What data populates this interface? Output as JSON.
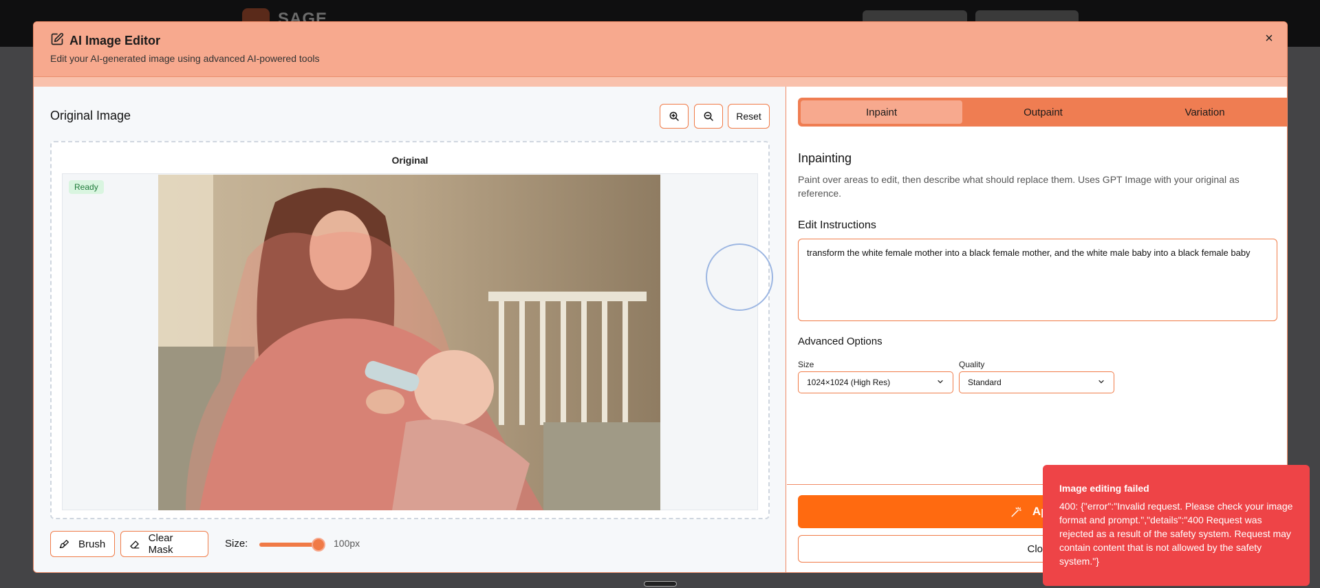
{
  "background": {
    "app_logo_text": "SAGE"
  },
  "modal": {
    "title": "AI Image Editor",
    "subtitle": "Edit your AI-generated image using advanced AI-powered tools",
    "close_symbol": "×"
  },
  "left": {
    "title": "Original Image",
    "reset_label": "Reset",
    "canvas_label": "Original",
    "status_badge": "Ready",
    "brush_label": "Brush",
    "clear_mask_label": "Clear Mask",
    "size_label": "Size:",
    "size_value": "100px",
    "brush_size_fraction": 1.0
  },
  "right": {
    "tabs": [
      {
        "label": "Inpaint",
        "active": true
      },
      {
        "label": "Outpaint",
        "active": false
      },
      {
        "label": "Variation",
        "active": false
      }
    ],
    "section_title": "Inpainting",
    "section_desc": "Paint over areas to edit, then describe what should replace them. Uses GPT Image with your original as reference.",
    "instructions_label": "Edit Instructions",
    "instructions_value": "transform the white female mother into a black female mother, and the white male baby into a black female baby",
    "advanced_title": "Advanced Options",
    "size_option_label": "Size",
    "size_option_value": "1024×1024 (High Res)",
    "quality_option_label": "Quality",
    "quality_option_value": "Standard",
    "apply_label": "Apply",
    "close_label": "Clos"
  },
  "toast": {
    "title": "Image editing failed",
    "message": "400: {\"error\":\"Invalid request. Please check your image format and prompt.\",\"details\":\"400 Request was rejected as a result of the safety system. Request may contain content that is not allowed by the safety system.\"}"
  },
  "colors": {
    "accent": "#f07a46",
    "header": "#f7a98e",
    "apply": "#ff6a10",
    "toast": "#ee4447"
  }
}
